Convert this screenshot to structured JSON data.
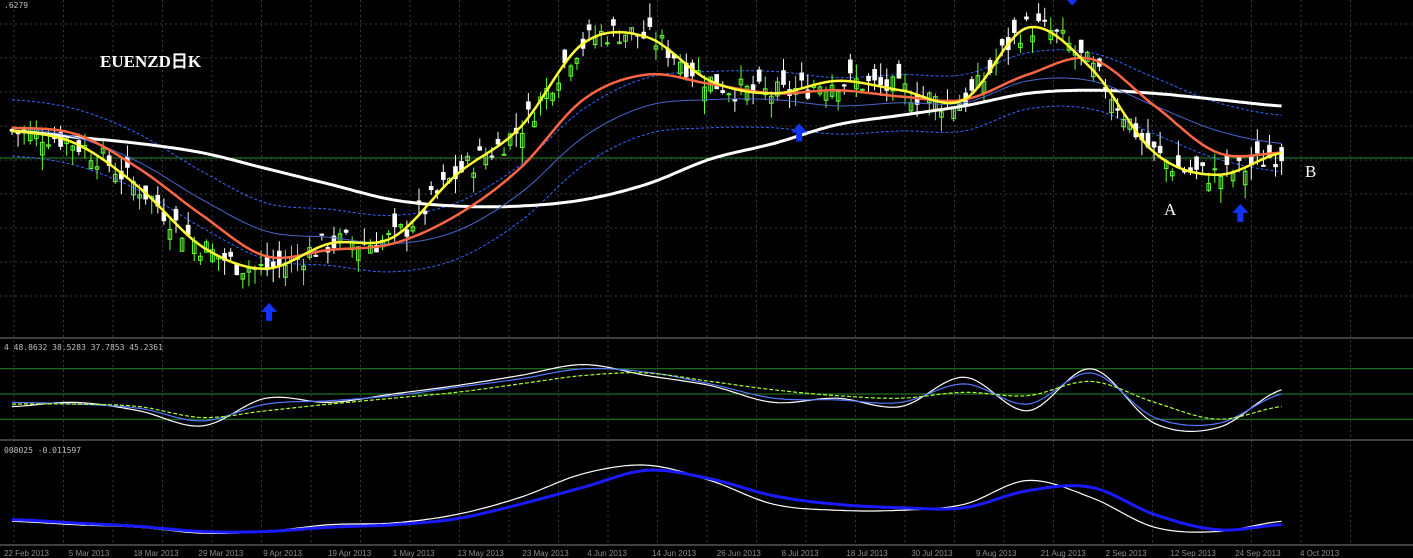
{
  "colors": {
    "background": "#000000",
    "grid": "#3a3a3a",
    "candle_up": "#66ff33",
    "candle_down": "#ffffff",
    "ma_fast": "#ffff33",
    "ma_mid": "#ff6644",
    "ma_slow": "#ffffff",
    "band": "#3366ff",
    "arrow": "#1133ff",
    "stoch_main": "#ffffff",
    "stoch_alt": "#5577ff",
    "stoch_signal": "#aaff33",
    "macd_main": "#ffffff",
    "macd_signal": "#1a1aff",
    "level_line": "#2a8a2a"
  },
  "price_panel": {
    "header": ".6279",
    "title": "EUENZD日K",
    "annotation_a": "A",
    "annotation_b": "B",
    "arrows": [
      "arrow-up",
      "arrow-down",
      "arrow-up",
      "arrow-down",
      "arrow-up"
    ]
  },
  "stoch_panel": {
    "header": "4 48.8632 38.5283 37.7853 45.2361"
  },
  "macd_panel": {
    "header": "008025 -0.011597"
  },
  "x_axis": {
    "labels": [
      "22 Feb 2013",
      "5 Mar 2013",
      "18 Mar 2013",
      "29 Mar 2013",
      "9 Apr 2013",
      "19 Apr 2013",
      "1 May 2013",
      "13 May 2013",
      "23 May 2013",
      "4 Jun 2013",
      "14 Jun 2013",
      "26 Jun 2013",
      "8 Jul 2013",
      "18 Jul 2013",
      "30 Jul 2013",
      "9 Aug 2013",
      "21 Aug 2013",
      "2 Sep 2013",
      "12 Sep 2013",
      "24 Sep 2013",
      "4 Oct 2013"
    ]
  },
  "chart_data": [
    {
      "type": "line",
      "title": "EUENZD日K",
      "x": [
        "22 Feb 2013",
        "5 Mar 2013",
        "18 Mar 2013",
        "29 Mar 2013",
        "9 Apr 2013",
        "19 Apr 2013",
        "1 May 2013",
        "13 May 2013",
        "23 May 2013",
        "4 Jun 2013",
        "14 Jun 2013",
        "26 Jun 2013",
        "8 Jul 2013",
        "18 Jul 2013",
        "30 Jul 2013",
        "9 Aug 2013",
        "21 Aug 2013",
        "2 Sep 2013",
        "12 Sep 2013",
        "24 Sep 2013",
        "4 Oct 2013"
      ],
      "y_scale": "relative price level, 0 = bottom of pane, 100 = top",
      "ylim": [
        0,
        100
      ],
      "series": [
        {
          "values": [
            62,
            58,
            44,
            25,
            18,
            26,
            28,
            48,
            63,
            90,
            92,
            78,
            74,
            78,
            75,
            72,
            95,
            82,
            55,
            48,
            55
          ]
        },
        {
          "values": [
            63,
            61,
            50,
            35,
            22,
            24,
            26,
            35,
            50,
            72,
            80,
            77,
            74,
            75,
            73,
            72,
            80,
            85,
            70,
            55,
            55
          ]
        },
        {
          "values": [
            63,
            60,
            52,
            40,
            30,
            28,
            26,
            30,
            42,
            60,
            70,
            72,
            72,
            70,
            71,
            71,
            78,
            78,
            70,
            62,
            58
          ]
        },
        {
          "values": [
            62,
            60,
            58,
            55,
            50,
            45,
            40,
            38,
            38,
            40,
            45,
            53,
            58,
            64,
            67,
            70,
            74,
            75,
            74,
            72,
            70
          ]
        }
      ]
    },
    {
      "type": "line",
      "title": "",
      "x": [
        "22 Feb 2013",
        "5 Mar 2013",
        "18 Mar 2013",
        "29 Mar 2013",
        "9 Apr 2013",
        "19 Apr 2013",
        "1 May 2013",
        "13 May 2013",
        "23 May 2013",
        "4 Jun 2013",
        "14 Jun 2013",
        "26 Jun 2013",
        "8 Jul 2013",
        "18 Jul 2013",
        "30 Jul 2013",
        "9 Aug 2013",
        "21 Aug 2013",
        "2 Sep 2013",
        "12 Sep 2013",
        "24 Sep 2013",
        "4 Oct 2013"
      ],
      "ylim": [
        0,
        100
      ],
      "levels": [
        80,
        50,
        20
      ],
      "series": [
        {
          "values": [
            35,
            40,
            30,
            12,
            45,
            40,
            50,
            60,
            72,
            85,
            72,
            60,
            40,
            45,
            35,
            70,
            30,
            80,
            15,
            10,
            55
          ]
        },
        {
          "values": [
            40,
            38,
            33,
            18,
            38,
            42,
            48,
            58,
            68,
            80,
            76,
            62,
            45,
            43,
            40,
            62,
            38,
            75,
            22,
            15,
            50
          ]
        },
        {
          "values": [
            38,
            38,
            35,
            22,
            30,
            38,
            45,
            52,
            62,
            72,
            75,
            65,
            55,
            48,
            45,
            52,
            48,
            65,
            40,
            20,
            35
          ]
        }
      ]
    },
    {
      "type": "line",
      "title": "",
      "x": [
        "22 Feb 2013",
        "5 Mar 2013",
        "18 Mar 2013",
        "29 Mar 2013",
        "9 Apr 2013",
        "19 Apr 2013",
        "1 May 2013",
        "13 May 2013",
        "23 May 2013",
        "4 Jun 2013",
        "14 Jun 2013",
        "26 Jun 2013",
        "8 Jul 2013",
        "18 Jul 2013",
        "30 Jul 2013",
        "9 Aug 2013",
        "21 Aug 2013",
        "2 Sep 2013",
        "12 Sep 2013",
        "24 Sep 2013",
        "4 Oct 2013"
      ],
      "ylim": [
        0,
        100
      ],
      "series": [
        {
          "values": [
            22,
            18,
            15,
            8,
            10,
            18,
            20,
            30,
            50,
            78,
            88,
            70,
            42,
            35,
            35,
            42,
            70,
            50,
            15,
            10,
            22
          ]
        },
        {
          "values": [
            24,
            20,
            16,
            10,
            10,
            15,
            18,
            25,
            42,
            62,
            82,
            72,
            52,
            42,
            38,
            38,
            58,
            62,
            30,
            12,
            18
          ]
        }
      ]
    }
  ]
}
